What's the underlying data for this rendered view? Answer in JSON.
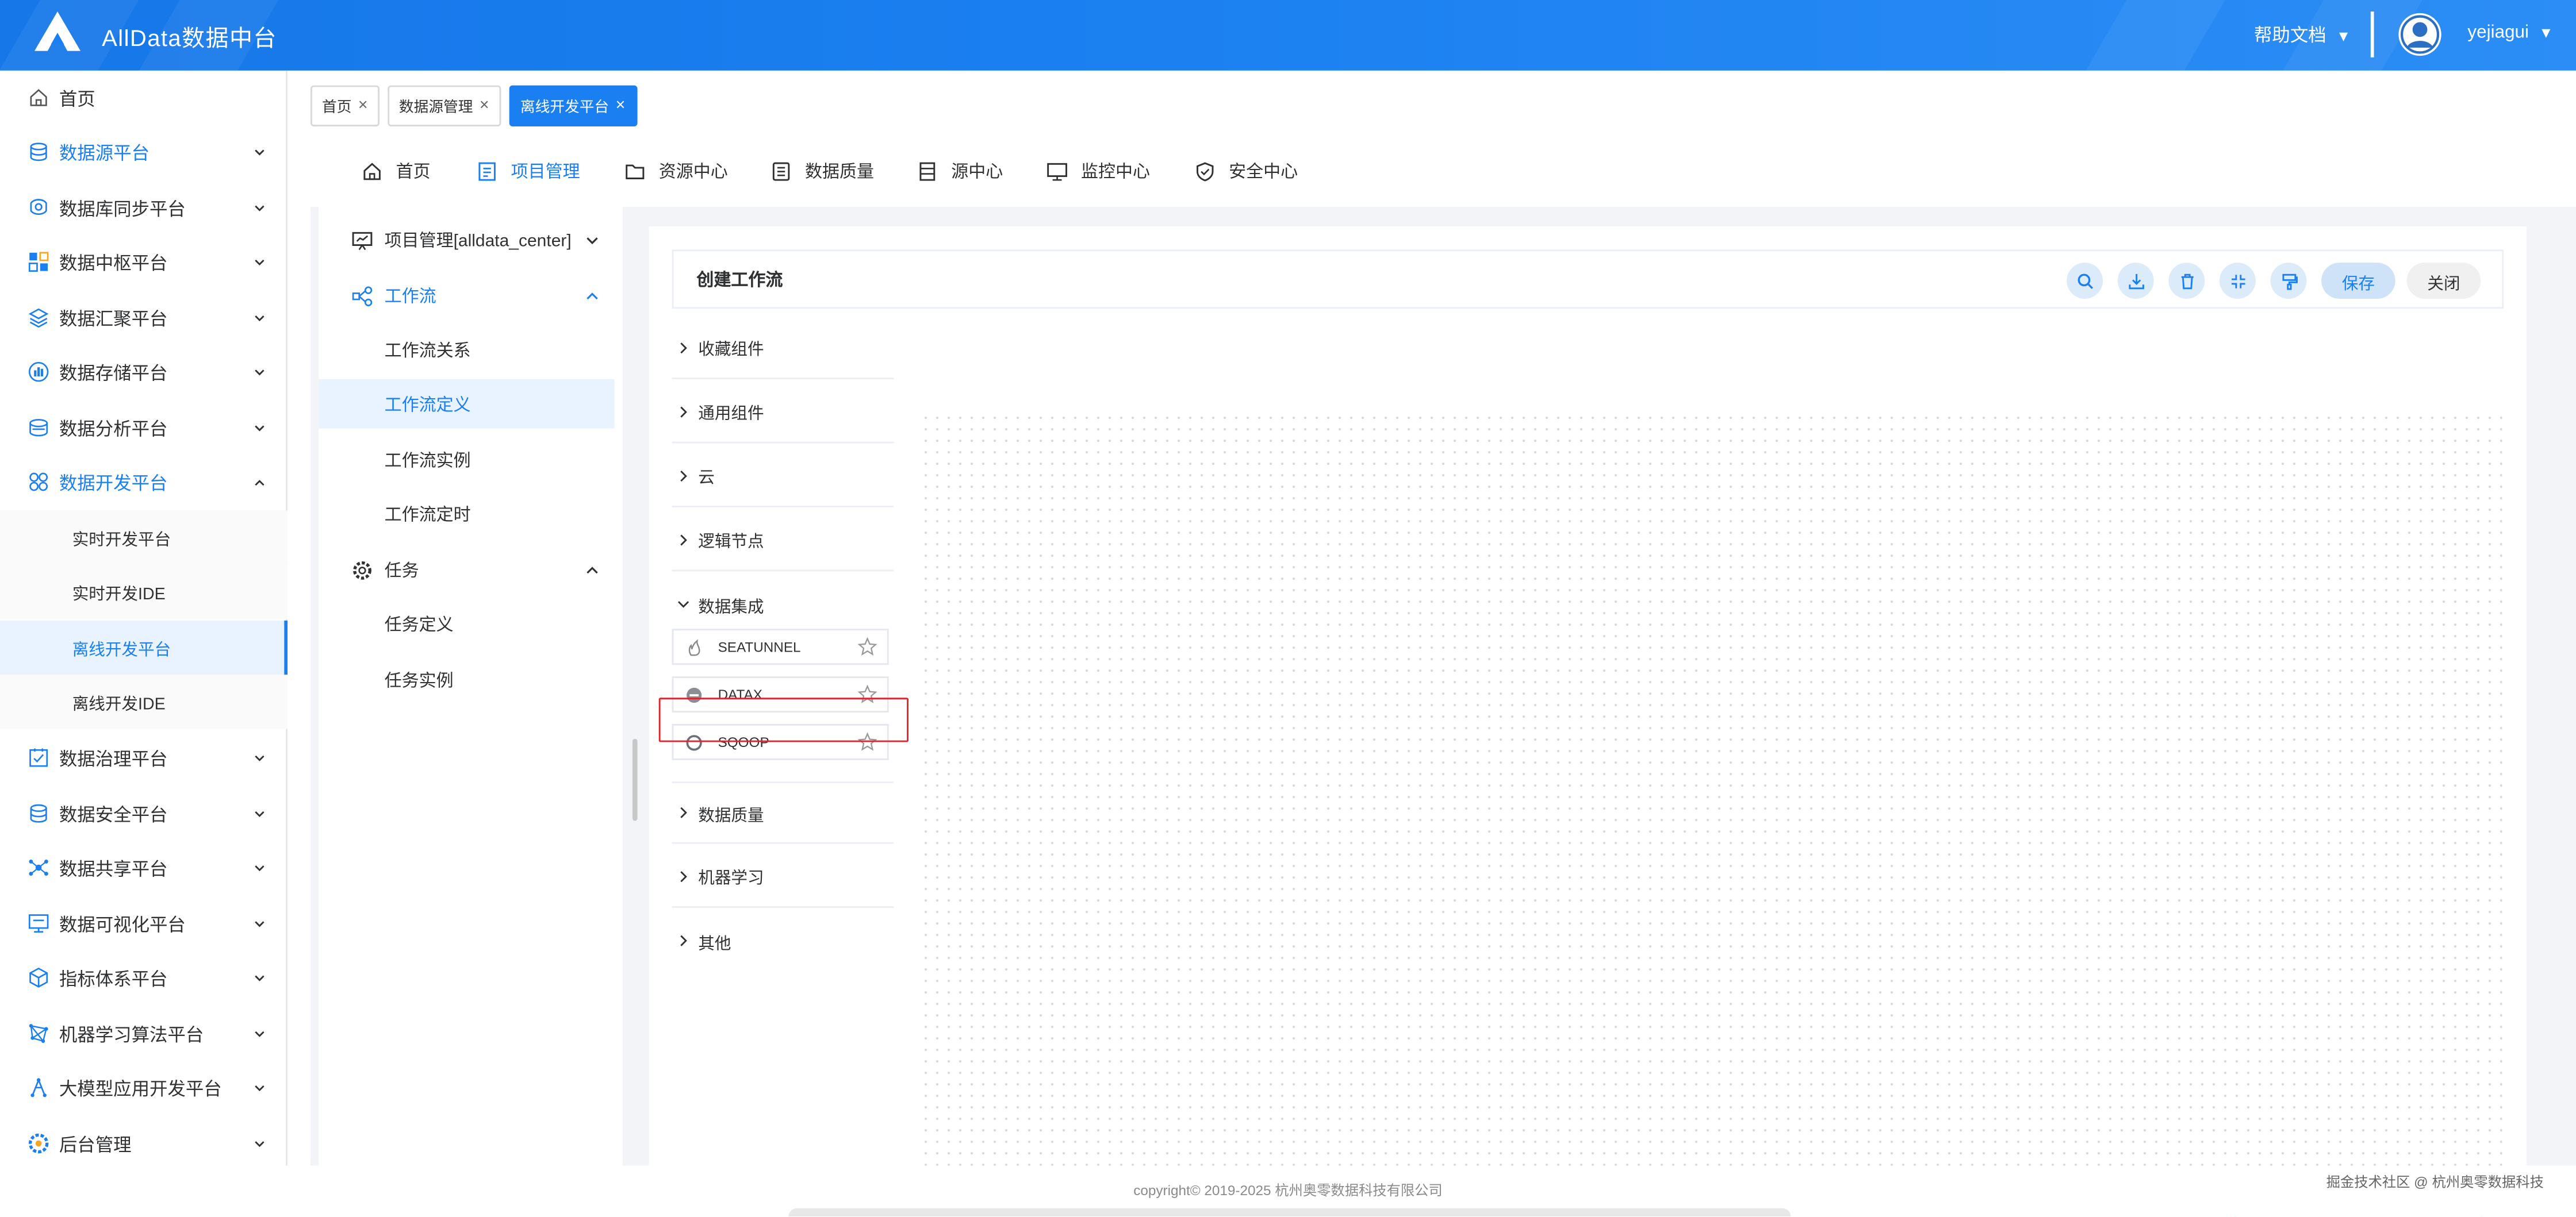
{
  "header": {
    "app_title": "AllData数据中台",
    "help_label": "帮助文档",
    "username": "yejiagui",
    "caret": "▼",
    "brand_color": "#1a7ff0"
  },
  "sidebar": {
    "items": [
      {
        "label": "首页",
        "icon": "home-icon"
      },
      {
        "label": "数据源平台",
        "icon": "database-icon"
      },
      {
        "label": "数据库同步平台",
        "icon": "sync-icon"
      },
      {
        "label": "数据中枢平台",
        "icon": "hub-icon"
      },
      {
        "label": "数据汇聚平台",
        "icon": "layers-icon"
      },
      {
        "label": "数据存储平台",
        "icon": "storage-icon"
      },
      {
        "label": "数据分析平台",
        "icon": "analysis-icon"
      },
      {
        "label": "数据开发平台",
        "icon": "dev-icon"
      },
      {
        "label": "数据治理平台",
        "icon": "governance-icon"
      },
      {
        "label": "数据安全平台",
        "icon": "security-icon"
      },
      {
        "label": "数据共享平台",
        "icon": "share-icon"
      },
      {
        "label": "数据可视化平台",
        "icon": "monitor-icon"
      },
      {
        "label": "指标体系平台",
        "icon": "cube-icon"
      },
      {
        "label": "机器学习算法平台",
        "icon": "ml-icon"
      },
      {
        "label": "大模型应用开发平台",
        "icon": "llm-icon"
      },
      {
        "label": "后台管理",
        "icon": "settings-icon"
      }
    ],
    "dev_sub_items": [
      {
        "label": "实时开发平台"
      },
      {
        "label": "实时开发IDE"
      },
      {
        "label": "离线开发平台"
      },
      {
        "label": "离线开发IDE"
      }
    ]
  },
  "tags": [
    {
      "label": "首页"
    },
    {
      "label": "数据源管理"
    },
    {
      "label": "离线开发平台"
    }
  ],
  "tag_close": "×",
  "topnav": [
    {
      "label": "首页",
      "icon": "home-icon"
    },
    {
      "label": "项目管理",
      "icon": "project-icon"
    },
    {
      "label": "资源中心",
      "icon": "folder-icon"
    },
    {
      "label": "数据质量",
      "icon": "quality-icon"
    },
    {
      "label": "源中心",
      "icon": "source-icon"
    },
    {
      "label": "监控中心",
      "icon": "monitor-icon"
    },
    {
      "label": "安全中心",
      "icon": "shield-icon"
    }
  ],
  "submenu": {
    "project": "项目管理[alldata_center]",
    "workflow": "工作流",
    "workflow_items": [
      "工作流关系",
      "工作流定义",
      "工作流实例",
      "工作流定时"
    ],
    "task": "任务",
    "task_items": [
      "任务定义",
      "任务实例"
    ]
  },
  "workflow": {
    "title": "创建工作流",
    "save_label": "保存",
    "close_label": "关闭",
    "tools": [
      "search-icon",
      "download-icon",
      "delete-icon",
      "fullscreen-icon",
      "format-icon"
    ]
  },
  "palette": {
    "categories_top": [
      "收藏组件",
      "通用组件",
      "云",
      "逻辑节点",
      "数据集成"
    ],
    "components": [
      "SEATUNNEL",
      "DATAX",
      "SQOOP"
    ],
    "categories_bottom": [
      "数据质量",
      "机器学习",
      "其他"
    ]
  },
  "footer": {
    "copyright": "copyright© 2019-2025 杭州奥零数据科技有限公司",
    "watermark": "掘金技术社区 @ 杭州奥零数据科技"
  }
}
